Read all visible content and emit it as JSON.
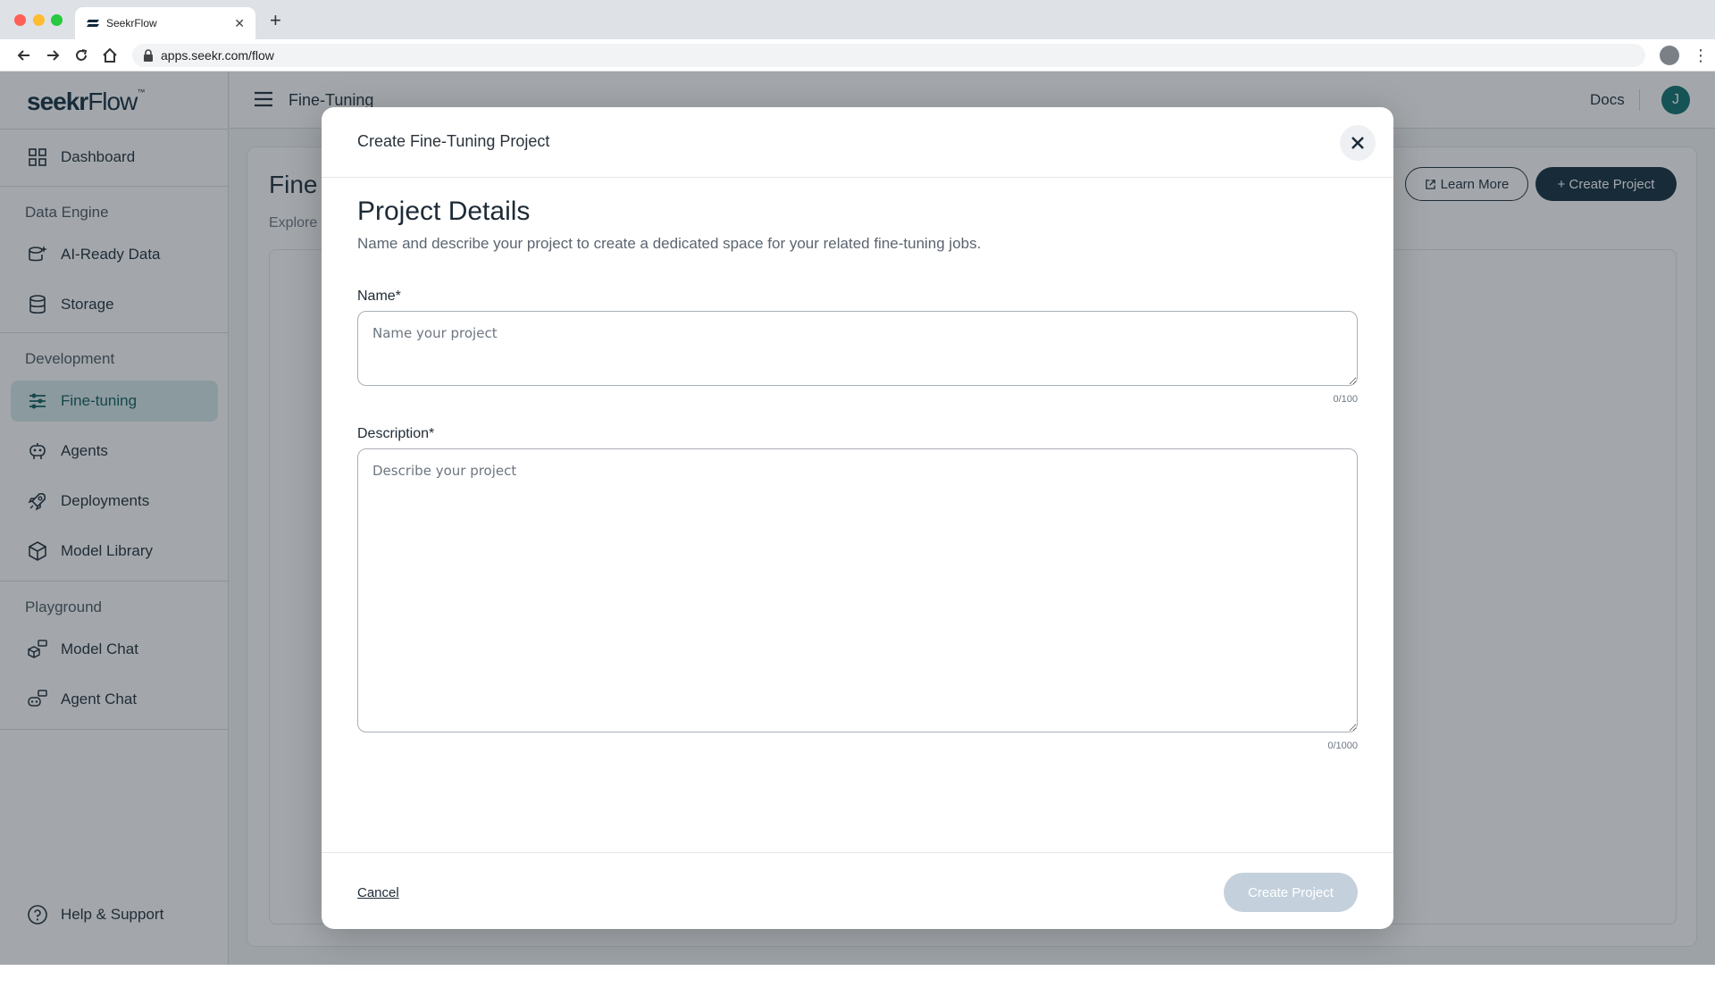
{
  "browser": {
    "tab_title": "SeekrFlow",
    "url": "apps.seekr.com/flow"
  },
  "sidebar": {
    "logo_bold": "seekr",
    "logo_light": "Flow",
    "logo_tm": "™",
    "dashboard": "Dashboard",
    "sections": {
      "data_engine": "Data Engine",
      "development": "Development",
      "playground": "Playground"
    },
    "items": {
      "ai_ready": "AI-Ready Data",
      "storage": "Storage",
      "fine_tuning": "Fine-tuning",
      "agents": "Agents",
      "deployments": "Deployments",
      "model_library": "Model Library",
      "model_chat": "Model Chat",
      "agent_chat": "Agent Chat"
    },
    "help": "Help & Support"
  },
  "topbar": {
    "title": "Fine-Tuning",
    "docs": "Docs",
    "avatar_initial": "J"
  },
  "page": {
    "title": "Fine",
    "subtitle": "Explore",
    "learn_more": "Learn More",
    "create_project": "+ Create Project"
  },
  "modal": {
    "title": "Create Fine-Tuning Project",
    "section_title": "Project Details",
    "section_subtitle": "Name and describe your project to create a dedicated space for your related fine-tuning jobs.",
    "name_label": "Name*",
    "name_placeholder": "Name your project",
    "name_value": "",
    "name_counter": "0/100",
    "description_label": "Description*",
    "description_placeholder": "Describe your project",
    "description_value": "",
    "description_counter": "0/1000",
    "cancel": "Cancel",
    "submit": "Create Project"
  },
  "colors": {
    "brand_dark": "#0f2a3b",
    "accent_teal": "#0d6e6e",
    "active_bg": "#d6e9e9",
    "submit_disabled": "#c4d1dd"
  }
}
